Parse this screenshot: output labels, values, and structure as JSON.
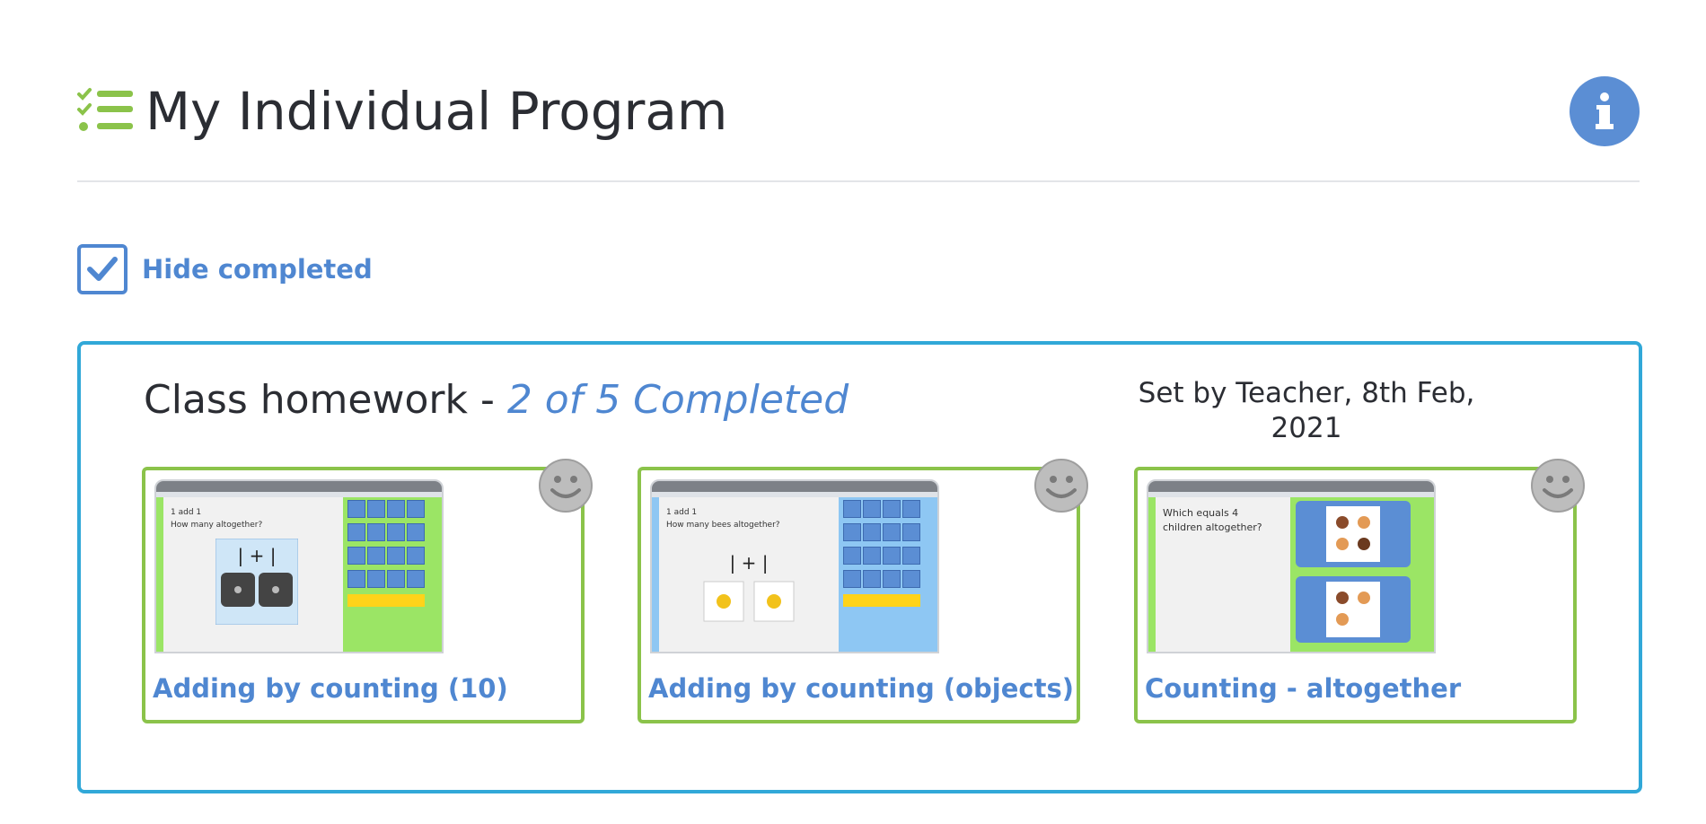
{
  "header": {
    "title": "My Individual Program",
    "list_icon": "checklist-icon",
    "info_icon": "info-icon"
  },
  "filter": {
    "hide_completed_label": "Hide completed",
    "hide_completed_checked": true
  },
  "homework": {
    "title_prefix": "Class homework - ",
    "status": "2 of 5 Completed",
    "set_by": "Set by Teacher, 8th Feb, 2021",
    "cards": [
      {
        "label": "Adding by counting (10)",
        "thumb_theme": "green",
        "thumb_text_1": "1 add 1",
        "thumb_text_2": "How many altogether?",
        "status_icon": "smiley-icon"
      },
      {
        "label": "Adding by counting (objects)",
        "thumb_theme": "blue",
        "thumb_text_1": "1 add 1",
        "thumb_text_2": "How many bees altogether?",
        "status_icon": "smiley-icon"
      },
      {
        "label": "Counting - altogether",
        "thumb_theme": "green",
        "thumb_text_1": "Which equals 4",
        "thumb_text_2": "children altogether?",
        "status_icon": "smiley-icon"
      }
    ]
  },
  "colors": {
    "accent": "#4f87d1",
    "card_border": "#8bc34a",
    "panel_border": "#31a8d8",
    "info": "#5b8ed4",
    "green_icon": "#8bc34a"
  }
}
